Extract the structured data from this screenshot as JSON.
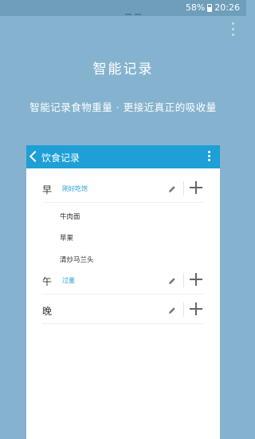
{
  "status_bar": {
    "battery": "58%",
    "time": "20:26"
  },
  "hero": {
    "title": "智能记录",
    "subtitle": "智能记录食物重量 · 更接近真正的吸收量"
  },
  "app": {
    "title": "饮食记录",
    "meals": [
      {
        "label": "早",
        "status": "刚好吃饱",
        "foods": [
          "牛肉面",
          "苹果",
          "清炒马兰头"
        ]
      },
      {
        "label": "午",
        "status": "过量",
        "foods": []
      },
      {
        "label": "晚",
        "status": "",
        "foods": []
      }
    ]
  },
  "colors": {
    "background": "#85b3cf",
    "app_bar": "#1e9fd6",
    "status_text": "#2a9fd8"
  },
  "icons": [
    "battery-icon",
    "overflow-menu-icon",
    "back-arrow-icon",
    "more-vert-icon",
    "edit-pencil-icon",
    "add-icon"
  ]
}
